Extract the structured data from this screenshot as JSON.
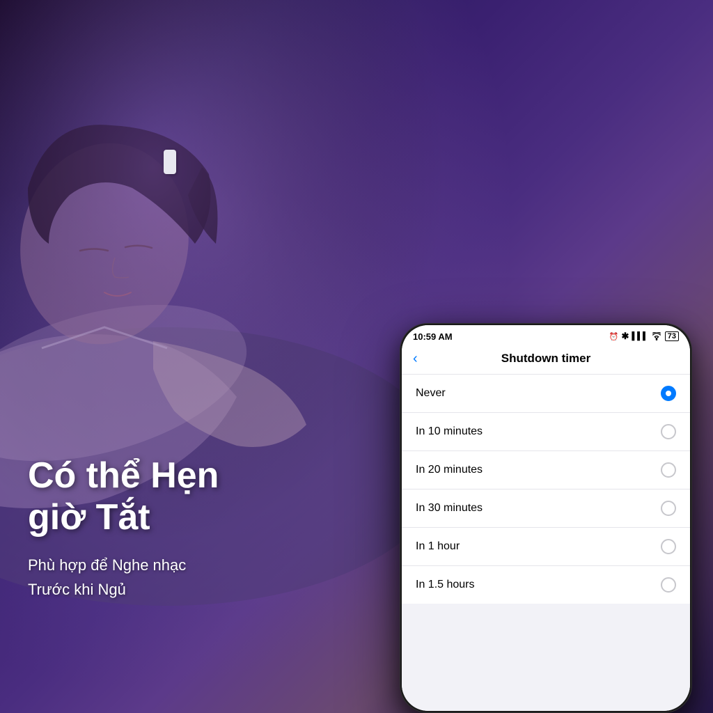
{
  "background": {
    "gradient": "purple-blue night scene"
  },
  "overlay_text": {
    "headline": "Có thể Hẹn\ngiờ Tắt",
    "subtext_line1": "Phù hợp để Nghe nhạc",
    "subtext_line2": "Trước khi Ngủ"
  },
  "phone": {
    "status_bar": {
      "time": "10:59 AM",
      "alarm_icon": "⏰",
      "bluetooth_icon": "✱",
      "signal_bars": "▌▌▌",
      "wifi_icon": "WiFi",
      "battery": "73"
    },
    "nav": {
      "title": "Shutdown timer",
      "back_label": "‹"
    },
    "timer_options": [
      {
        "label": "Never",
        "selected": true
      },
      {
        "label": "In 10 minutes",
        "selected": false
      },
      {
        "label": "In 20 minutes",
        "selected": false
      },
      {
        "label": "In 30 minutes",
        "selected": false
      },
      {
        "label": "In 1 hour",
        "selected": false
      },
      {
        "label": "In 1.5 hours",
        "selected": false
      }
    ]
  }
}
